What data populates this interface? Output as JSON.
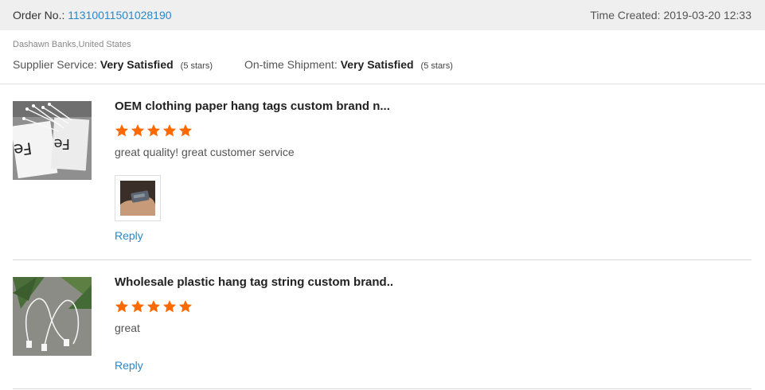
{
  "order": {
    "label": "Order No.:",
    "number": "11310011501028190",
    "time_created": "Time Created: 2019-03-20 12:33"
  },
  "buyer": {
    "name_location": "Dashawn Banks,United States"
  },
  "ratings": {
    "supplier_label": "Supplier Service:",
    "supplier_value": "Very Satisfied",
    "supplier_stars": "(5 stars)",
    "shipment_label": "On-time Shipment:",
    "shipment_value": "Very Satisfied",
    "shipment_stars": "(5 stars)"
  },
  "reviews": [
    {
      "title": "OEM clothing paper hang tags custom brand n...",
      "stars": 5,
      "comment": "great quality! great customer service",
      "has_photo": true,
      "reply_label": "Reply"
    },
    {
      "title": "Wholesale plastic hang tag string custom brand..",
      "stars": 5,
      "comment": "great",
      "has_photo": false,
      "reply_label": "Reply"
    }
  ],
  "colors": {
    "accent": "#2a88c8",
    "star": "#ff6a00",
    "bar_bg": "#efefef"
  }
}
